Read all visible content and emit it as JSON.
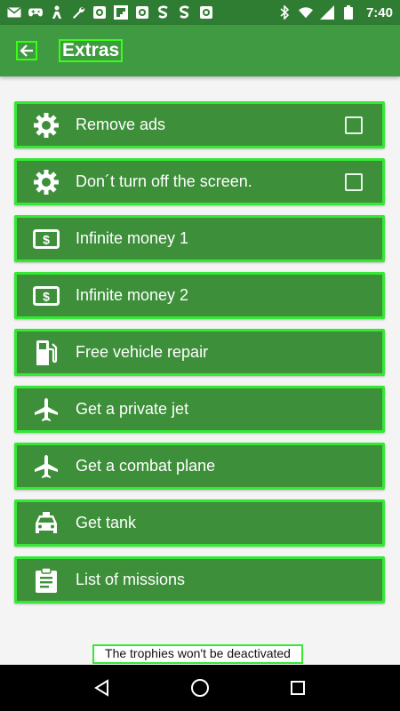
{
  "status_bar": {
    "time": "7:40",
    "left_icons": [
      "mail-icon",
      "game-controller-icon",
      "person-icon",
      "wrench-icon",
      "safe-icon",
      "flipboard-icon",
      "safe-icon",
      "s-logo-icon",
      "s-logo-icon",
      "safe-icon"
    ],
    "right_icons": [
      "bluetooth-icon",
      "wifi-icon",
      "signal-icon",
      "battery-icon"
    ]
  },
  "app_bar": {
    "title": "Extras",
    "back_icon": "arrow-back-icon"
  },
  "items": [
    {
      "label": "Remove ads",
      "icon": "gear-icon",
      "checkbox": true,
      "checked": false
    },
    {
      "label": "Don´t turn off the screen.",
      "icon": "gear-icon",
      "checkbox": true,
      "checked": false
    },
    {
      "label": "Infinite money 1",
      "icon": "money-icon",
      "checkbox": false
    },
    {
      "label": "Infinite money 2",
      "icon": "money-icon",
      "checkbox": false
    },
    {
      "label": "Free vehicle repair",
      "icon": "fuel-pump-icon",
      "checkbox": false
    },
    {
      "label": "Get a private jet",
      "icon": "airplane-icon",
      "checkbox": false
    },
    {
      "label": "Get a combat plane",
      "icon": "airplane-icon",
      "checkbox": false
    },
    {
      "label": "Get tank",
      "icon": "taxi-icon",
      "checkbox": false
    },
    {
      "label": "List of missions",
      "icon": "clipboard-icon",
      "checkbox": false
    }
  ],
  "footer": {
    "note": "The trophies won't be deactivated"
  },
  "nav_bar": {
    "back_icon": "nav-back-icon",
    "home_icon": "nav-home-icon",
    "recents_icon": "nav-recents-icon"
  },
  "colors": {
    "status_bar": "#2f7d32",
    "app_bar": "#3f9a41",
    "item_bg": "#3d8f3a",
    "highlight": "#34e833"
  }
}
